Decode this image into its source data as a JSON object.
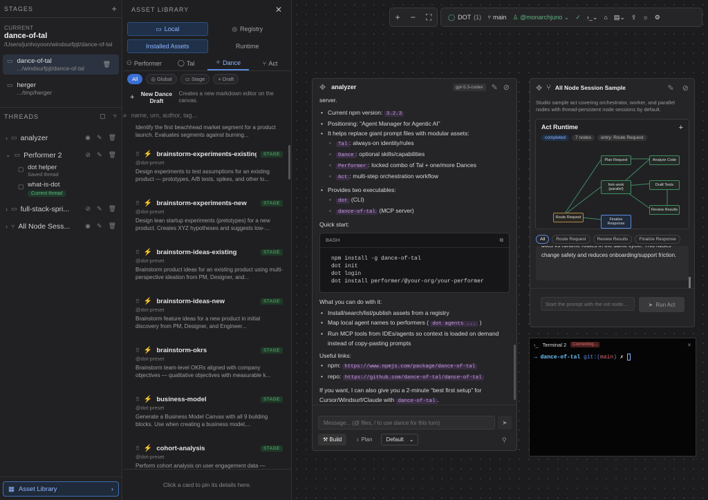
{
  "stages": {
    "title": "STAGES",
    "current_label": "CURRENT",
    "current_name": "dance-of-tal",
    "current_path": "/Users/junhoyoon/windsurfpjt/dance-of-tal",
    "items": [
      {
        "name": "dance-of-tal",
        "path": ".../windsurfpjt/dance-of-tal"
      },
      {
        "name": "herger",
        "path": ".../tmp/herger"
      }
    ]
  },
  "threads": {
    "title": "THREADS",
    "items": [
      {
        "label": "analyzer"
      },
      {
        "label": "Performer 2",
        "subs": [
          {
            "title": "dot helper",
            "sub": "Saved thread"
          },
          {
            "title": "what-is-dot",
            "sub": "Current thread"
          }
        ]
      },
      {
        "label": "full-stack-spri..."
      },
      {
        "label": "All Node Sess..."
      }
    ]
  },
  "asset_library_button": "Asset Library",
  "library": {
    "title": "ASSET LIBRARY",
    "seg1": [
      "Local",
      "Registry"
    ],
    "seg2": [
      "Installed Assets",
      "Runtime"
    ],
    "tabs": [
      "Performer",
      "Tal",
      "Dance",
      "Act"
    ],
    "chips": [
      "All",
      "Global",
      "Stage",
      "Draft"
    ],
    "new_title": "New Dance Draft",
    "new_desc": "Creates a new markdown editor on the canvas.",
    "search_placeholder": "name, urn, author, tag...",
    "first_desc": "Identify the first beachhead market segment for a product launch. Evaluates segments against burning...",
    "cards": [
      {
        "name": "brainstorm-experiments-existing",
        "by": "@dot-preset",
        "desc": "Design experiments to test assumptions for an existing product — prototypes, A/B tests, spikes, and other lo..."
      },
      {
        "name": "brainstorm-experiments-new",
        "by": "@dot-preset",
        "desc": "Design lean startup experiments (pretotypes) for a new product. Creates XYZ hypotheses and suggests low-..."
      },
      {
        "name": "brainstorm-ideas-existing",
        "by": "@dot-preset",
        "desc": "Brainstorm product ideas for an existing product using multi-perspective ideation from PM, Designer, and..."
      },
      {
        "name": "brainstorm-ideas-new",
        "by": "@dot-preset",
        "desc": "Brainstorm feature ideas for a new product in initial discovery from PM, Designer, and Engineer..."
      },
      {
        "name": "brainstorm-okrs",
        "by": "@dot-preset",
        "desc": "Brainstorm team-level OKRs aligned with company objectives — qualitative objectives with measurable k..."
      },
      {
        "name": "business-model",
        "by": "@dot-preset",
        "desc": "Generate a Business Model Canvas with all 9 building blocks. Use when creating a business model,..."
      },
      {
        "name": "cohort-analysis",
        "by": "@dot-preset",
        "desc": "Perform cohort analysis on user engagement data —"
      }
    ],
    "stage_badge": "STAGE",
    "footer": "Click a card to pin its details here."
  },
  "topbar": {
    "dot": "DOT",
    "dot_count": "(1)",
    "branch": "main",
    "user": "@monarchjuno"
  },
  "analyzer": {
    "title": "analyzer",
    "model": "gpt-5.3-codex",
    "server": "server.",
    "bullets": {
      "npm": "Current npm version: ",
      "npm_v": "3.2.3",
      "pos": "Positioning: “Agent Manager for Agentic AI”",
      "replace": "It helps replace giant prompt files with modular assets:",
      "tal": "Tal",
      "tal_d": ": always-on identity/rules",
      "dance": "Dance",
      "dance_d": ": optional skills/capabilities",
      "perf": "Performer",
      "perf_d": ": locked combo of Tal + one/more Dances",
      "act": "Act",
      "act_d": ": multi-step orchestration workflow",
      "exes": "Provides two executables:",
      "dot": "dot",
      "dot_d": " (CLI)",
      "mcp": "dance-of-tal",
      "mcp_d": " (MCP server)"
    },
    "quick": "Quick start:",
    "code_lang": "BASH",
    "code": "npm install -g dance-of-tal\ndot init\ndot login\ndot install performer/@your-org/your-performer",
    "can_do": "What you can do with it:",
    "can": [
      "Install/search/list/publish assets from a registry",
      "Map local agent names to performers ( ",
      "Run MCP tools from IDEs/agents so context is loaded on demand instead of copy-pasting prompts"
    ],
    "dot_agents": "dot agents ...",
    "useful": "Useful links:",
    "npm_lbl": "npm: ",
    "npm_url": "https://www.npmjs.com/package/dance-of-tal",
    "repo_lbl": "repo: ",
    "repo_url": "https://github.com/dance-of-tal/dance-of-tal",
    "tail": "If you want, I can also give you a 2-minute “best first setup” for Cursor/Windsurf/Claude with ",
    "tail_tag": "dance-of-tal",
    "input_placeholder": "Message... (@ files, / to use dance for this turn)",
    "build": "Build",
    "plan": "Plan",
    "mode": "Default"
  },
  "session": {
    "title": "All Node Session Sample",
    "desc": "Studio sample act covering orchestrator, worker, and parallel nodes with thread-persistent node sessions by default.",
    "runtime": "Act Runtime",
    "status": "completed",
    "nodes": "7 nodes",
    "entry": "entry: Route Request",
    "graph": [
      "Plan Request",
      "Analyze Code",
      "fork-work (parallel)",
      "Draft Tests",
      "Review Results",
      "Route Request",
      "Finalize Response"
    ],
    "filters": [
      "All",
      "Route Request",
      "Review Results",
      "Finalize Response"
    ],
    "text": "docs vs runtime routes in the same cycle. This raises change safety and reduces onboarding/support friction.",
    "prompt_placeholder": "Start the prompt with the init node...",
    "run": "Run Act"
  },
  "terminal": {
    "title": "Terminal 2",
    "status": "Connecting...",
    "prompt": "dance-of-tal",
    "git": "git:(",
    "branch": "main",
    "git_end": ")"
  }
}
